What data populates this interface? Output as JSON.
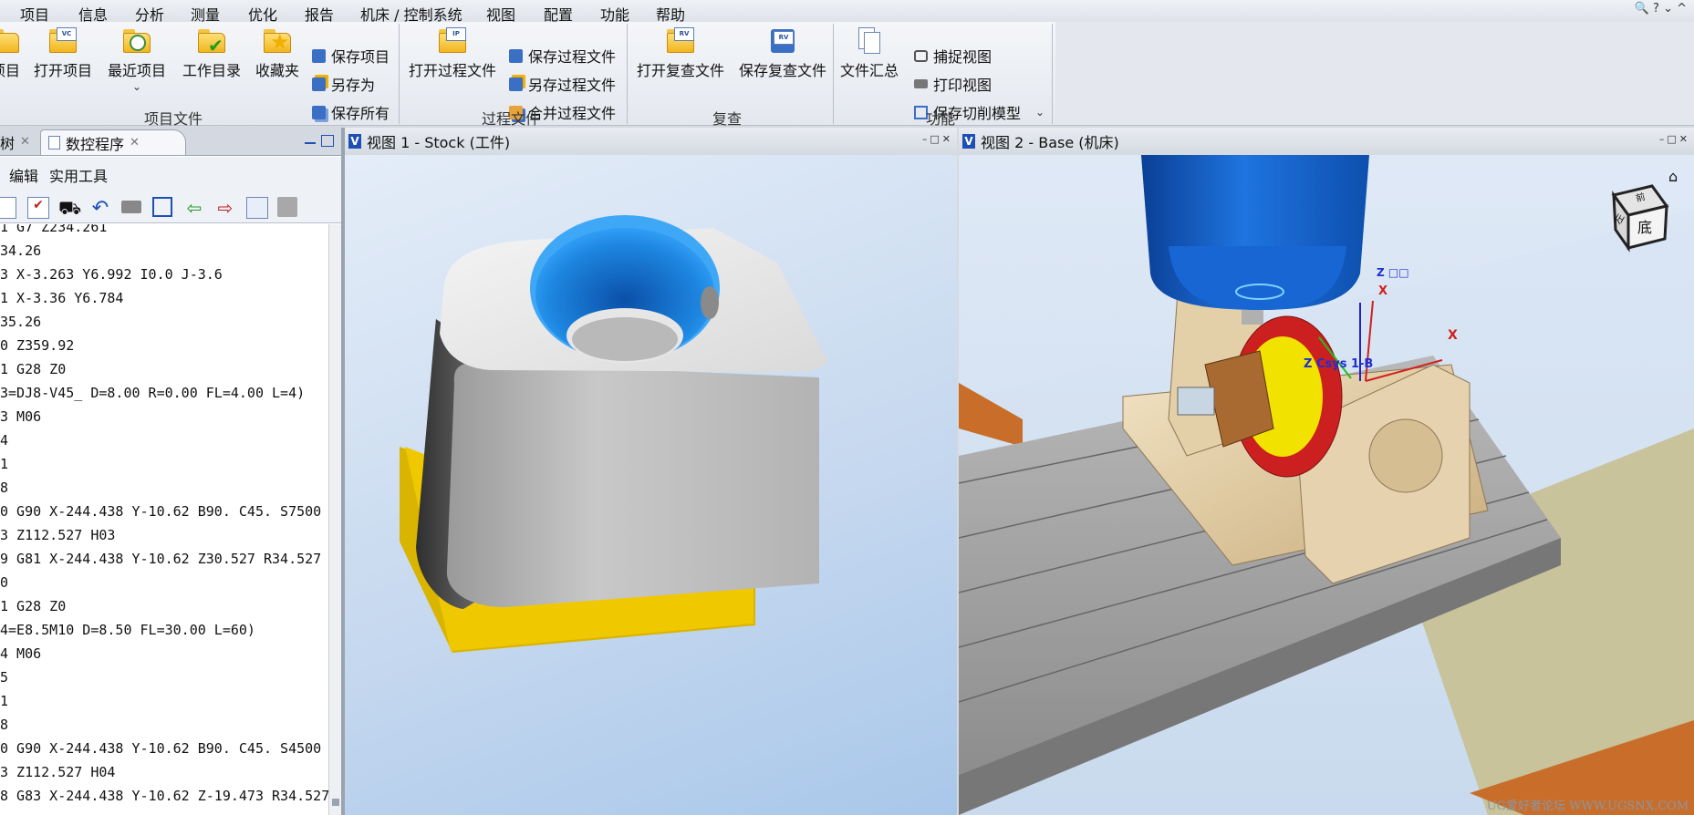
{
  "menu": [
    "项目",
    "信息",
    "分析",
    "测量",
    "优化",
    "报告",
    "机床 / 控制系统",
    "视图",
    "配置",
    "功能",
    "帮助"
  ],
  "window_controls": "🔍 ? ⌄ ^",
  "ribbon": {
    "project_files": {
      "label": "项目文件",
      "big_buttons": [
        "项目",
        "打开项目",
        "最近项目",
        "工作目录",
        "收藏夹"
      ],
      "small_buttons": [
        "保存项目",
        "另存为",
        "保存所有"
      ]
    },
    "process_files": {
      "label": "过程文件",
      "big_buttons": [
        "打开过程文件"
      ],
      "small_buttons": [
        "保存过程文件",
        "另存过程文件",
        "合并过程文件"
      ]
    },
    "review": {
      "label": "复查",
      "big_buttons": [
        "打开复查文件",
        "保存复查文件"
      ]
    },
    "function": {
      "label": "功能",
      "big_buttons": [
        "文件汇总"
      ],
      "small_buttons": [
        "捕捉视图",
        "打印视图",
        "保存切削模型"
      ]
    },
    "icon_tags": {
      "vc": "VC",
      "ip": "IP",
      "rv_open": "RV",
      "rv_save": "RV"
    }
  },
  "left_panel": {
    "tabs": [
      "树",
      "数控程序"
    ],
    "menus": [
      "编辑",
      "实用工具"
    ],
    "code_lines": [
      "1 G7 Z234.261",
      "34.26",
      "3 X-3.263 Y6.992 I0.0 J-3.6",
      "1 X-3.36 Y6.784",
      "35.26",
      "0 Z359.92",
      "1 G28 Z0",
      "3=DJ8-V45_ D=8.00 R=0.00 FL=4.00 L=4)",
      "3 M06",
      "4",
      "1",
      "8",
      "0 G90 X-244.438 Y-10.62 B90. C45. S7500",
      "3 Z112.527 H03",
      "9 G81 X-244.438 Y-10.62 Z30.527 R34.527",
      "0",
      "1 G28 Z0",
      "4=E8.5M10 D=8.50 FL=30.00 L=60)",
      "4 M06",
      "5",
      "1",
      "8",
      "0 G90 X-244.438 Y-10.62 B90. C45. S4500",
      "3 Z112.527 H04",
      "8 G83 X-244.438 Y-10.62 Z-19.473 R34.527"
    ]
  },
  "view1": {
    "badge": "V",
    "title": "视图 1 - Stock (工件)"
  },
  "view2": {
    "badge": "V",
    "title": "视图 2 - Base (机床)",
    "axis_labels": {
      "z_top": "Z □□",
      "x_top": "X",
      "x_right": "X",
      "z_csys": "Z Csys 1-B"
    },
    "cube_faces": [
      "左",
      "底",
      "前"
    ]
  },
  "watermark": "UG爱好者论坛 WWW.UGSNX.COM",
  "colors": {
    "accent": "#1d4fb5",
    "stock_yellow": "#f0c800",
    "bore_blue": "#1d86e0",
    "spindle_blue": "#0d5cc7",
    "fixture_tan": "#e3cfa8"
  }
}
